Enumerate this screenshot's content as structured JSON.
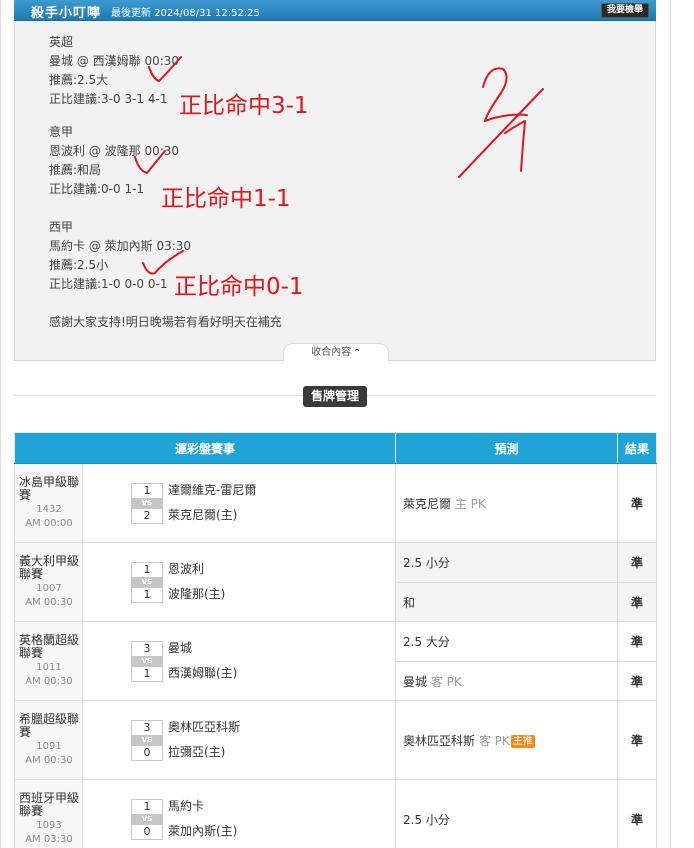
{
  "header": {
    "title": "殺手小叮嚀",
    "updated": "最後更新 2024/08/31 12:52:25",
    "report_button": "我要檢舉"
  },
  "article": {
    "sections": [
      {
        "league": "英超",
        "match": "曼城 @ 西漢姆聯 00:30",
        "pick": "推薦:2.5大",
        "score_tip": "正比建議:3-0 3-1 4-1",
        "annotation": "正比命中3-1"
      },
      {
        "league": "意甲",
        "match": "恩波利 @ 波隆那 00:30",
        "pick": "推薦:和局",
        "score_tip": "正比建議:0-0 1-1",
        "annotation": "正比命中1-1"
      },
      {
        "league": "西甲",
        "match": "馬約卡 @ 萊加內斯 03:30",
        "pick": "推薦:2.5小",
        "score_tip": "正比建議:1-0 0-0 0-1",
        "annotation": "正比命中0-1"
      }
    ],
    "closing": "感謝大家支持!明日晚場若有看好明天在補充",
    "collapse_label": "收合內容"
  },
  "sale_section": {
    "label": "售牌管理"
  },
  "table": {
    "headers": [
      "運彩盤賽事",
      "預測",
      "結果"
    ],
    "games": [
      {
        "league": "冰島甲級聯賽",
        "code": "1432",
        "time": "AM 00:00",
        "score_top": "1",
        "score_bottom": "2",
        "team_top": "達爾維克-雷尼爾",
        "team_bottom": "萊克尼爾(主)",
        "predictions": [
          {
            "main": "萊克尼爾",
            "sub": "主 PK",
            "tag": "",
            "result": "準"
          }
        ]
      },
      {
        "league": "義大利甲級聯賽",
        "code": "1007",
        "time": "AM 00:30",
        "score_top": "1",
        "score_bottom": "1",
        "team_top": "恩波利",
        "team_bottom": "波隆那(主)",
        "predictions": [
          {
            "main": "2.5 小分",
            "sub": "",
            "tag": "",
            "result": "準"
          },
          {
            "main": "和",
            "sub": "",
            "tag": "",
            "result": "準"
          }
        ]
      },
      {
        "league": "英格蘭超級聯賽",
        "code": "1011",
        "time": "AM 00:30",
        "score_top": "3",
        "score_bottom": "1",
        "team_top": "曼城",
        "team_bottom": "西漢姆聯(主)",
        "predictions": [
          {
            "main": "2.5 大分",
            "sub": "",
            "tag": "",
            "result": "準"
          },
          {
            "main": "曼城",
            "sub": "客 PK",
            "tag": "",
            "result": "準"
          }
        ]
      },
      {
        "league": "希臘超級聯賽",
        "code": "1091",
        "time": "AM 00:30",
        "score_top": "3",
        "score_bottom": "0",
        "team_top": "奧林匹亞科斯",
        "team_bottom": "拉彌亞(主)",
        "predictions": [
          {
            "main": "奧林匹亞科斯",
            "sub": "客 PK",
            "tag": "主推",
            "result": "準"
          }
        ]
      },
      {
        "league": "西班牙甲級聯賽",
        "code": "1093",
        "time": "AM 03:30",
        "score_top": "1",
        "score_bottom": "0",
        "team_top": "馬約卡",
        "team_bottom": "萊加內斯(主)",
        "predictions": [
          {
            "main": "2.5 小分",
            "sub": "",
            "tag": "",
            "result": "準"
          }
        ]
      }
    ]
  },
  "colors": {
    "header_blue": "#1fa4d8",
    "annotation_red": "#e3141c",
    "result_green": "#1a8d3a",
    "tag_orange": "#f38a1e"
  }
}
